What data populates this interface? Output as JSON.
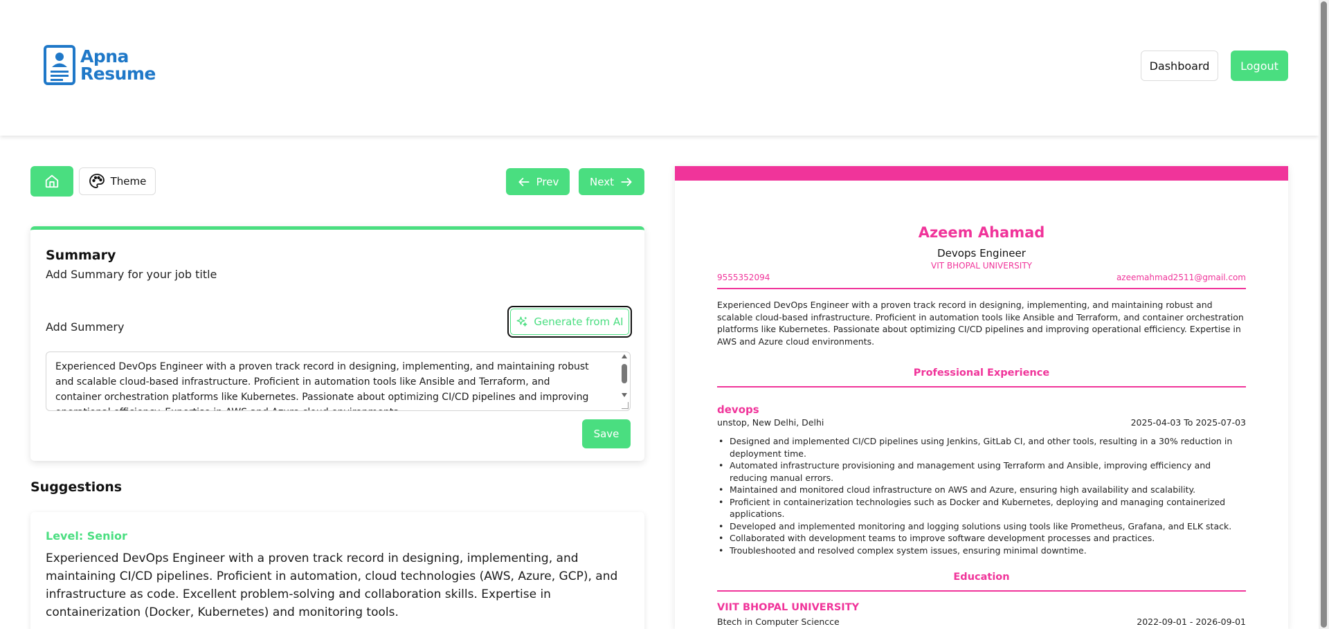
{
  "header": {
    "logo_line1": "Apna",
    "logo_line2": "Resume",
    "dashboard_label": "Dashboard",
    "logout_label": "Logout"
  },
  "toolbar": {
    "theme_label": "Theme",
    "prev_label": "Prev",
    "next_label": "Next"
  },
  "summary_card": {
    "title": "Summary",
    "subtitle": "Add Summary for your job title",
    "field_label": "Add Summery",
    "generate_label": "Generate from AI",
    "text": "Experienced DevOps Engineer with a proven track record in designing, implementing, and maintaining robust and scalable cloud-based infrastructure.  Proficient in automation tools like Ansible and Terraform, and container orchestration platforms like Kubernetes.  Passionate about optimizing CI/CD pipelines and improving operational efficiency.  Expertise in AWS and Azure cloud environments.",
    "save_label": "Save"
  },
  "suggestions": {
    "title": "Suggestions",
    "items": [
      {
        "level": "Level: Senior",
        "text": "Experienced DevOps Engineer with a proven track record in designing, implementing, and maintaining CI/CD pipelines. Proficient in automation, cloud technologies (AWS, Azure, GCP), and infrastructure as code. Excellent problem-solving and collaboration skills. Expertise in containerization (Docker, Kubernetes) and monitoring tools."
      }
    ]
  },
  "resume": {
    "theme_color": "#f0349a",
    "name": "Azeem Ahamad",
    "job_title": "Devops Engineer",
    "university": "VIT BHOPAL UNIVERSITY",
    "phone": "9555352094",
    "email": "azeemahmad2511@gmail.com",
    "summary": "Experienced DevOps Engineer with a proven track record in designing, implementing, and maintaining robust and scalable cloud-based infrastructure. Proficient in automation tools like Ansible and Terraform, and container orchestration platforms like Kubernetes. Passionate about optimizing CI/CD pipelines and improving operational efficiency. Expertise in AWS and Azure cloud environments.",
    "experience_heading": "Professional Experience",
    "experience": [
      {
        "title": "devops",
        "location": "unstop, New Delhi, Delhi",
        "dates": "2025-04-03 To 2025-07-03",
        "bullets": [
          "Designed and implemented CI/CD pipelines using Jenkins, GitLab CI, and other tools, resulting in a 30% reduction in deployment time.",
          "Automated infrastructure provisioning and management using Terraform and Ansible, improving efficiency and reducing manual errors.",
          "Maintained and monitored cloud infrastructure on AWS and Azure, ensuring high availability and scalability.",
          "Proficient in containerization technologies such as Docker and Kubernetes, deploying and managing containerized applications.",
          "Developed and implemented monitoring and logging solutions using tools like Prometheus, Grafana, and ELK stack.",
          "Collaborated with development teams to improve software development processes and practices.",
          "Troubleshooted and resolved complex system issues, ensuring minimal downtime."
        ]
      }
    ],
    "education_heading": "Education",
    "education": [
      {
        "name": "VIIT BHOPAL UNIVERSITY",
        "degree": "Btech in Computer Sciencce",
        "dates": "2022-09-01 - 2026-09-01"
      }
    ]
  },
  "colors": {
    "accent": "#4ade80",
    "logo": "#1f78c8",
    "resume_theme": "#f0349a"
  },
  "icons": {
    "logo": "resume-document-icon",
    "home": "home-icon",
    "theme": "palette-icon",
    "prev": "arrow-left-icon",
    "next": "arrow-right-icon",
    "generate": "sparkles-icon"
  }
}
